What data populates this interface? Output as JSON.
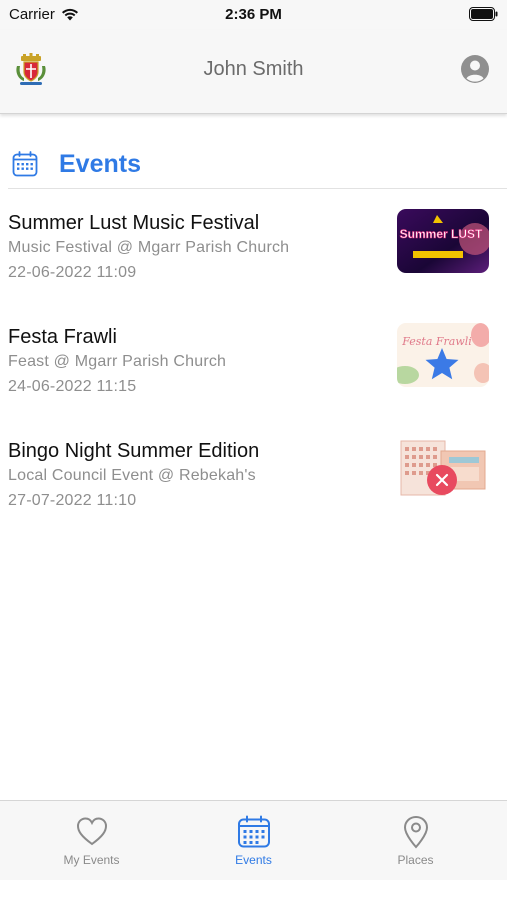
{
  "status_bar": {
    "carrier": "Carrier",
    "time": "2:36 PM"
  },
  "header": {
    "user_name": "John Smith"
  },
  "section": {
    "title": "Events"
  },
  "events": [
    {
      "title": "Summer Lust Music Festival",
      "subtitle": "Music Festival @ Mgarr Parish Church",
      "datetime": "22-06-2022 11:09",
      "thumb_text": "Summer LUST"
    },
    {
      "title": "Festa Frawli",
      "subtitle": "Feast @ Mgarr Parish Church",
      "datetime": "24-06-2022 11:15",
      "thumb_text": "Festa Frawli"
    },
    {
      "title": "Bingo Night Summer Edition",
      "subtitle": "Local Council Event @ Rebekah's",
      "datetime": "27-07-2022 11:10",
      "thumb_text": ""
    }
  ],
  "tabs": [
    {
      "label": "My Events",
      "icon": "heart-icon"
    },
    {
      "label": "Events",
      "icon": "calendar-icon"
    },
    {
      "label": "Places",
      "icon": "map-pin-icon"
    }
  ],
  "colors": {
    "accent": "#2f7ae5",
    "inactive": "#8a8a8a",
    "favorite_star": "#3b7ae6",
    "remove_badge": "#e84a5f"
  }
}
